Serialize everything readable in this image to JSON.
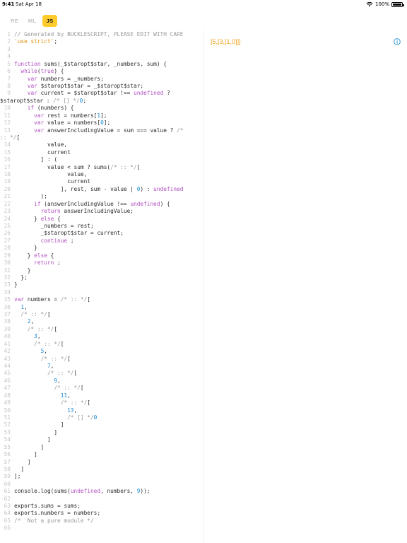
{
  "status_bar": {
    "time": "9:41",
    "date": "Sat Apr 18",
    "battery": "100%"
  },
  "tabs": [
    {
      "label": "RE",
      "active": false
    },
    {
      "label": "ML",
      "active": false
    },
    {
      "label": "JS",
      "active": true
    }
  ],
  "colors": {
    "accent": "#ffcb2b",
    "comment": "#9a9a9a",
    "string": "#e0900b",
    "keyword": "#b04ec0",
    "number": "#1a8ad6",
    "output": "#f0a019",
    "info": "#1a8ad6"
  },
  "output": {
    "text": "[5,[3,[1,0]]]"
  },
  "icons": {
    "info": "info-circle-icon",
    "wifi": "wifi-icon",
    "battery": "battery-icon"
  },
  "code": {
    "lines": [
      {
        "n": "1",
        "t": [
          [
            "c",
            "// Generated by BUCKLESCRIPT, PLEASE EDIT WITH CARE"
          ]
        ]
      },
      {
        "n": "2",
        "t": [
          [
            "s",
            "'use strict'"
          ],
          [
            "p",
            ";"
          ]
        ]
      },
      {
        "n": "3",
        "t": []
      },
      {
        "n": "4",
        "t": []
      },
      {
        "n": "5",
        "t": [
          [
            "k",
            "function"
          ],
          [
            "p",
            " sums(_$staropt$star, _numbers, sum) {"
          ]
        ]
      },
      {
        "n": "6",
        "t": [
          [
            "p",
            "  "
          ],
          [
            "k",
            "while"
          ],
          [
            "p",
            "("
          ],
          [
            "k",
            "true"
          ],
          [
            "p",
            ") {"
          ]
        ]
      },
      {
        "n": "7",
        "t": [
          [
            "p",
            "    "
          ],
          [
            "k",
            "var"
          ],
          [
            "p",
            " numbers = _numbers;"
          ]
        ]
      },
      {
        "n": "8",
        "t": [
          [
            "p",
            "    "
          ],
          [
            "k",
            "var"
          ],
          [
            "p",
            " $staropt$star = _$staropt$star;"
          ]
        ]
      },
      {
        "n": "9",
        "wrap": true,
        "t": [
          [
            "p",
            "    "
          ],
          [
            "k",
            "var"
          ],
          [
            "p",
            " current = $staropt$star !== "
          ],
          [
            "k",
            "undefined"
          ],
          [
            "p",
            " ? $staropt$star : "
          ],
          [
            "c",
            "/* [] */"
          ],
          [
            "n",
            "0"
          ],
          [
            "p",
            ";"
          ]
        ]
      },
      {
        "n": "10",
        "t": [
          [
            "p",
            "    "
          ],
          [
            "k",
            "if"
          ],
          [
            "p",
            " (numbers) {"
          ]
        ]
      },
      {
        "n": "11",
        "t": [
          [
            "p",
            "      "
          ],
          [
            "k",
            "var"
          ],
          [
            "p",
            " rest = numbers["
          ],
          [
            "n",
            "1"
          ],
          [
            "p",
            "];"
          ]
        ]
      },
      {
        "n": "12",
        "t": [
          [
            "p",
            "      "
          ],
          [
            "k",
            "var"
          ],
          [
            "p",
            " value = numbers["
          ],
          [
            "n",
            "0"
          ],
          [
            "p",
            "];"
          ]
        ]
      },
      {
        "n": "13",
        "wrap": true,
        "t": [
          [
            "p",
            "      "
          ],
          [
            "k",
            "var"
          ],
          [
            "p",
            " answerIncludingValue = sum === value ? "
          ],
          [
            "c",
            "/* :: */"
          ],
          [
            "p",
            "["
          ]
        ]
      },
      {
        "n": "14",
        "t": [
          [
            "p",
            "          value,"
          ]
        ]
      },
      {
        "n": "15",
        "t": [
          [
            "p",
            "          current"
          ]
        ]
      },
      {
        "n": "16",
        "t": [
          [
            "p",
            "        ] : ("
          ]
        ]
      },
      {
        "n": "17",
        "t": [
          [
            "p",
            "          value < sum ? sums("
          ],
          [
            "c",
            "/* :: */"
          ],
          [
            "p",
            "["
          ]
        ]
      },
      {
        "n": "18",
        "t": [
          [
            "p",
            "                value,"
          ]
        ]
      },
      {
        "n": "19",
        "t": [
          [
            "p",
            "                current"
          ]
        ]
      },
      {
        "n": "20",
        "t": [
          [
            "p",
            "              ], rest, sum - value | "
          ],
          [
            "n",
            "0"
          ],
          [
            "p",
            ") : "
          ],
          [
            "k",
            "undefined"
          ]
        ]
      },
      {
        "n": "21",
        "t": [
          [
            "p",
            "        );"
          ]
        ]
      },
      {
        "n": "22",
        "t": [
          [
            "p",
            "      "
          ],
          [
            "k",
            "if"
          ],
          [
            "p",
            " (answerIncludingValue !== "
          ],
          [
            "k",
            "undefined"
          ],
          [
            "p",
            ") {"
          ]
        ]
      },
      {
        "n": "23",
        "t": [
          [
            "p",
            "        "
          ],
          [
            "k",
            "return"
          ],
          [
            "p",
            " answerIncludingValue;"
          ]
        ]
      },
      {
        "n": "24",
        "t": [
          [
            "p",
            "      } "
          ],
          [
            "k",
            "else"
          ],
          [
            "p",
            " {"
          ]
        ]
      },
      {
        "n": "25",
        "t": [
          [
            "p",
            "        _numbers = rest;"
          ]
        ]
      },
      {
        "n": "26",
        "t": [
          [
            "p",
            "        _$staropt$star = current;"
          ]
        ]
      },
      {
        "n": "27",
        "t": [
          [
            "p",
            "        "
          ],
          [
            "k",
            "continue"
          ],
          [
            "p",
            " ;"
          ]
        ]
      },
      {
        "n": "28",
        "t": [
          [
            "p",
            "      }"
          ]
        ]
      },
      {
        "n": "29",
        "t": [
          [
            "p",
            "    } "
          ],
          [
            "k",
            "else"
          ],
          [
            "p",
            " {"
          ]
        ]
      },
      {
        "n": "30",
        "t": [
          [
            "p",
            "      "
          ],
          [
            "k",
            "return"
          ],
          [
            "p",
            " ;"
          ]
        ]
      },
      {
        "n": "31",
        "t": [
          [
            "p",
            "    }"
          ]
        ]
      },
      {
        "n": "32",
        "t": [
          [
            "p",
            "  };"
          ]
        ]
      },
      {
        "n": "33",
        "t": [
          [
            "p",
            "}"
          ]
        ]
      },
      {
        "n": "34",
        "t": []
      },
      {
        "n": "35",
        "t": [
          [
            "k",
            "var"
          ],
          [
            "p",
            " numbers = "
          ],
          [
            "c",
            "/* :: */"
          ],
          [
            "p",
            "["
          ]
        ]
      },
      {
        "n": "36",
        "t": [
          [
            "p",
            "  "
          ],
          [
            "n",
            "1"
          ],
          [
            "p",
            ","
          ]
        ]
      },
      {
        "n": "37",
        "t": [
          [
            "p",
            "  "
          ],
          [
            "c",
            "/* :: */"
          ],
          [
            "p",
            "["
          ]
        ]
      },
      {
        "n": "38",
        "t": [
          [
            "p",
            "    "
          ],
          [
            "n",
            "2"
          ],
          [
            "p",
            ","
          ]
        ]
      },
      {
        "n": "39",
        "t": [
          [
            "p",
            "    "
          ],
          [
            "c",
            "/* :: */"
          ],
          [
            "p",
            "["
          ]
        ]
      },
      {
        "n": "40",
        "t": [
          [
            "p",
            "      "
          ],
          [
            "n",
            "3"
          ],
          [
            "p",
            ","
          ]
        ]
      },
      {
        "n": "41",
        "t": [
          [
            "p",
            "      "
          ],
          [
            "c",
            "/* :: */"
          ],
          [
            "p",
            "["
          ]
        ]
      },
      {
        "n": "42",
        "t": [
          [
            "p",
            "        "
          ],
          [
            "n",
            "5"
          ],
          [
            "p",
            ","
          ]
        ]
      },
      {
        "n": "43",
        "t": [
          [
            "p",
            "        "
          ],
          [
            "c",
            "/* :: */"
          ],
          [
            "p",
            "["
          ]
        ]
      },
      {
        "n": "44",
        "t": [
          [
            "p",
            "          "
          ],
          [
            "n",
            "7"
          ],
          [
            "p",
            ","
          ]
        ]
      },
      {
        "n": "45",
        "t": [
          [
            "p",
            "          "
          ],
          [
            "c",
            "/* :: */"
          ],
          [
            "p",
            "["
          ]
        ]
      },
      {
        "n": "46",
        "t": [
          [
            "p",
            "            "
          ],
          [
            "n",
            "9"
          ],
          [
            "p",
            ","
          ]
        ]
      },
      {
        "n": "47",
        "t": [
          [
            "p",
            "            "
          ],
          [
            "c",
            "/* :: */"
          ],
          [
            "p",
            "["
          ]
        ]
      },
      {
        "n": "48",
        "t": [
          [
            "p",
            "              "
          ],
          [
            "n",
            "11"
          ],
          [
            "p",
            ","
          ]
        ]
      },
      {
        "n": "49",
        "t": [
          [
            "p",
            "              "
          ],
          [
            "c",
            "/* :: */"
          ],
          [
            "p",
            "["
          ]
        ]
      },
      {
        "n": "50",
        "t": [
          [
            "p",
            "                "
          ],
          [
            "n",
            "13"
          ],
          [
            "p",
            ","
          ]
        ]
      },
      {
        "n": "51",
        "t": [
          [
            "p",
            "                "
          ],
          [
            "c",
            "/* [] */"
          ],
          [
            "n",
            "0"
          ]
        ]
      },
      {
        "n": "52",
        "t": [
          [
            "p",
            "              ]"
          ]
        ]
      },
      {
        "n": "53",
        "t": [
          [
            "p",
            "            ]"
          ]
        ]
      },
      {
        "n": "54",
        "t": [
          [
            "p",
            "          ]"
          ]
        ]
      },
      {
        "n": "55",
        "t": [
          [
            "p",
            "        ]"
          ]
        ]
      },
      {
        "n": "56",
        "t": [
          [
            "p",
            "      ]"
          ]
        ]
      },
      {
        "n": "57",
        "t": [
          [
            "p",
            "    ]"
          ]
        ]
      },
      {
        "n": "58",
        "t": [
          [
            "p",
            "  ]"
          ]
        ]
      },
      {
        "n": "59",
        "t": [
          [
            "p",
            "];"
          ]
        ]
      },
      {
        "n": "60",
        "t": []
      },
      {
        "n": "61",
        "t": [
          [
            "p",
            "console.log(sums("
          ],
          [
            "k",
            "undefined"
          ],
          [
            "p",
            ", numbers, "
          ],
          [
            "n",
            "9"
          ],
          [
            "p",
            "));"
          ]
        ]
      },
      {
        "n": "62",
        "t": []
      },
      {
        "n": "63",
        "t": [
          [
            "p",
            "exports.sums = sums;"
          ]
        ]
      },
      {
        "n": "64",
        "t": [
          [
            "p",
            "exports.numbers = numbers;"
          ]
        ]
      },
      {
        "n": "65",
        "t": [
          [
            "c",
            "/*  Not a pure module */"
          ]
        ]
      },
      {
        "n": "66",
        "t": []
      }
    ]
  }
}
